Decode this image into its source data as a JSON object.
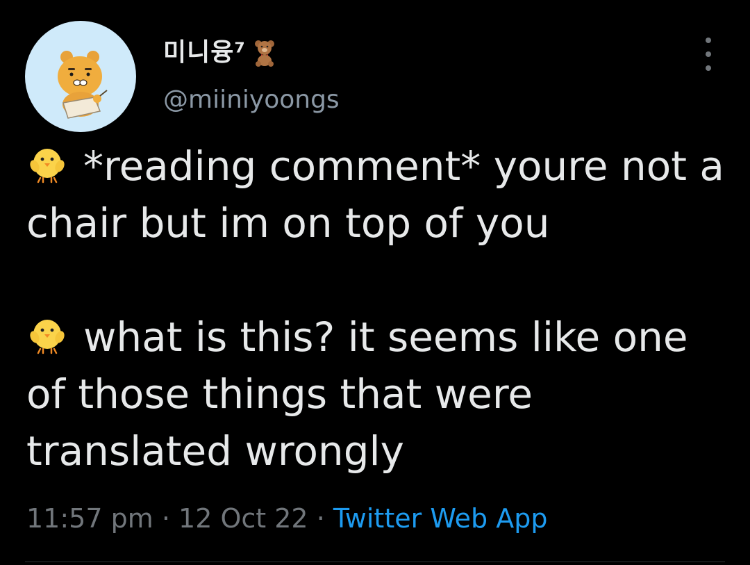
{
  "user": {
    "display_name": "미니융⁷",
    "name_icon": "teddy-bear-emoji",
    "handle": "@miiniyoongs",
    "avatar": "ryan-character-avatar"
  },
  "tweet": {
    "paragraphs": [
      {
        "icon": "baby-chick-emoji",
        "text": "*reading comment* youre not a chair but im on top of you"
      },
      {
        "icon": "baby-chick-emoji",
        "text": "what is this? it seems like one of those things that were translated wrongly"
      }
    ],
    "time": "11:57 pm",
    "separator": "·",
    "date": "12 Oct 22",
    "source": "Twitter Web App"
  },
  "colors": {
    "background": "#000000",
    "text": "#e7e9ea",
    "muted": "#71767b",
    "link": "#1d9bf0",
    "avatar_bg": "#cfeafa"
  }
}
